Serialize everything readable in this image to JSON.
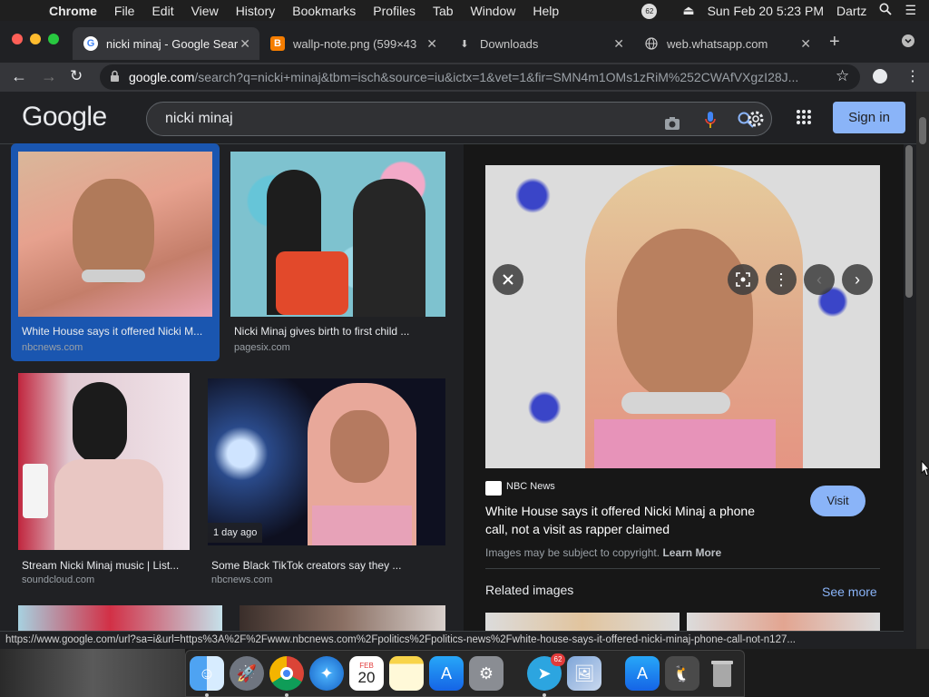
{
  "menubar": {
    "items": [
      "Chrome",
      "File",
      "Edit",
      "View",
      "History",
      "Bookmarks",
      "Profiles",
      "Tab",
      "Window",
      "Help"
    ],
    "badge": "62",
    "datetime": "Sun Feb 20  5:23 PM",
    "user": "Dartz"
  },
  "tabs": [
    {
      "label": "nicki minaj - Google Sear",
      "icon": "google-g-icon"
    },
    {
      "label": "wallp-note.png (599×43",
      "icon": "blogger-icon"
    },
    {
      "label": "Downloads",
      "icon": "download-icon"
    },
    {
      "label": "web.whatsapp.com",
      "icon": "globe-icon"
    }
  ],
  "omnibox": {
    "host": "google.com",
    "path": "/search?q=nicki+minaj&tbm=isch&source=iu&ictx=1&vet=1&fir=SMN4m1OMs1zRiM%252CWAfVXgzI28J..."
  },
  "google": {
    "logo": "Google",
    "query": "nicki minaj",
    "signin_label": "Sign in"
  },
  "results": [
    {
      "caption": "White House says it offered Nicki M...",
      "source": "nbcnews.com"
    },
    {
      "caption": "Nicki Minaj gives birth to first child ...",
      "source": "pagesix.com"
    },
    {
      "caption": "Stream Nicki Minaj music | List...",
      "source": "soundcloud.com"
    },
    {
      "caption": "Some Black TikTok creators say they ...",
      "source": "nbcnews.com",
      "badge": "1 day ago"
    }
  ],
  "panel": {
    "source": "NBC News",
    "title_line1": "White House says it offered Nicki Minaj a phone",
    "title_line2": "call, not a visit as rapper claimed",
    "copyright": "Images may be subject to copyright.",
    "learn_more": "Learn More",
    "visit_label": "Visit",
    "related": "Related images",
    "see_more": "See more"
  },
  "status_url": "https://www.google.com/url?sa=i&url=https%3A%2F%2Fwww.nbcnews.com%2Fpolitics%2Fpolitics-news%2Fwhite-house-says-it-offered-nicki-minaj-phone-call-not-n127...",
  "colors": {
    "accent": "#8ab4f8",
    "selected": "#1a56b0",
    "page_bg": "#202124"
  },
  "dock": {
    "calendar_month": "FEB",
    "calendar_day": "20",
    "telegram_badge": "62"
  }
}
